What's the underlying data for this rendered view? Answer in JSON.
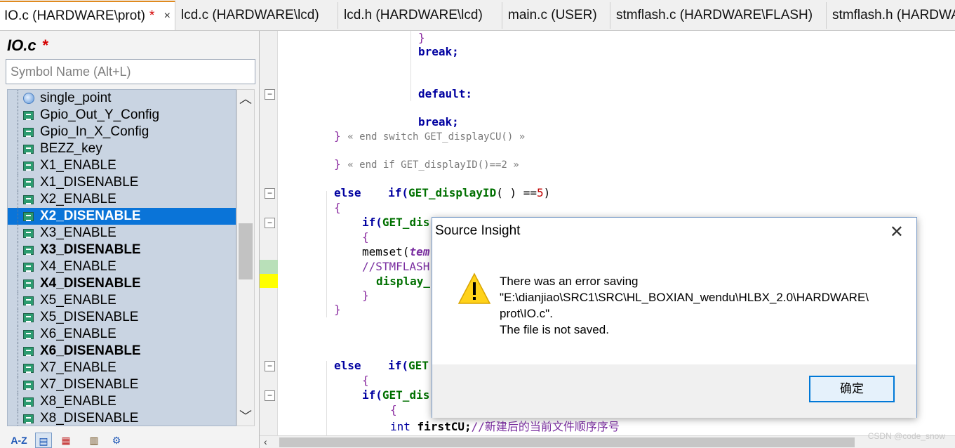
{
  "tabs": [
    {
      "label": "IO.c (HARDWARE\\prot)",
      "modified": "*",
      "close": "×"
    },
    {
      "label": "lcd.c (HARDWARE\\lcd)"
    },
    {
      "label": "lcd.h (HARDWARE\\lcd)"
    },
    {
      "label": "main.c (USER)"
    },
    {
      "label": "stmflash.c (HARDWARE\\FLASH)"
    },
    {
      "label": "stmflash.h (HARDWARE\\FLASH)"
    }
  ],
  "panel": {
    "file_title": "IO.c",
    "modified_mark": "*",
    "search_placeholder": "Symbol Name (Alt+L)",
    "symbols": [
      "single_point",
      "Gpio_Out_Y_Config",
      "Gpio_In_X_Config",
      "BEZZ_key",
      "X1_ENABLE",
      "X1_DISENABLE",
      "X2_ENABLE",
      "X2_DISENABLE",
      "X3_ENABLE",
      "X3_DISENABLE",
      "X4_ENABLE",
      "X4_DISENABLE",
      "X5_ENABLE",
      "X5_DISENABLE",
      "X6_ENABLE",
      "X6_DISENABLE",
      "X7_ENABLE",
      "X7_DISENABLE",
      "X8_ENABLE",
      "X8_DISENABLE"
    ],
    "toolbar_sort_label": "A-Z"
  },
  "code": {
    "brace_close": "}",
    "break1": "break;",
    "default_kw": "default:",
    "break2": "break;",
    "end_switch_brace": "}",
    "end_switch_cmt": "« end switch GET_displayCU() »",
    "end_if_brace": "}",
    "end_if_cmt": "« end if GET_displayID()==2 »",
    "else1_kw": "else",
    "else1_if": "if(",
    "else1_fn": "GET_displayID",
    "else1_rest": "( ) ==",
    "else1_num": "5",
    "else1_close": ")",
    "open1": "{",
    "if_gd": "if(",
    "if_gd_fn": "GET_dis",
    "open2": "{",
    "memset": "memset(",
    "memset_arg": "tem",
    "stmflash_cmt": "//STMFLASH",
    "display_fn": "display_",
    "close2": "}",
    "close1": "}",
    "else2_kw": "else",
    "else2_if": "if(",
    "else2_fn": "GET",
    "open3": "{",
    "if2": "if(",
    "if2_fn": "GET_dis",
    "open4": "{",
    "int_kw": "int",
    "first_var": "firstCU;",
    "first_cmt": "//新建后的当前文件顺序序号"
  },
  "dialog": {
    "title": "Source Insight",
    "close": "✕",
    "line1": "There was an error saving",
    "line2": "\"E:\\dianjiao\\SRC1\\SRC\\HL_BOXIAN_wendu\\HLBX_2.0\\HARDWARE\\",
    "line3": "prot\\IO.c\".",
    "line4": "The file is not saved.",
    "ok": "确定"
  },
  "watermark": "CSDN @code_snow",
  "colors": {
    "selection": "#0a74d8",
    "warning": "#ffd21a",
    "accent_tab": "#e08a1e"
  }
}
